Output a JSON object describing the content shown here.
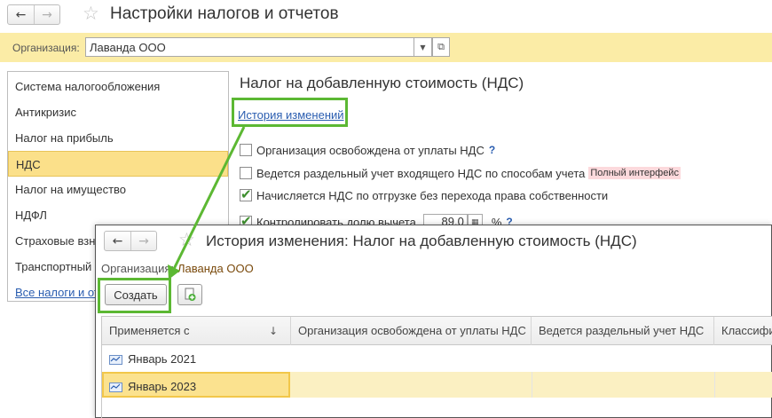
{
  "main_window": {
    "title": "Настройки налогов и отчетов",
    "nav_back": "←",
    "nav_forward": "→",
    "favorite_icon": "star-icon",
    "organization": {
      "label": "Организация:",
      "value": "Лаванда ООО",
      "dropdown_icon": "▼",
      "open_icon": "⧉"
    },
    "sidebar": {
      "items": [
        {
          "label": "Система налогообложения"
        },
        {
          "label": "Антикризис"
        },
        {
          "label": "Налог на прибыль"
        },
        {
          "label": "НДС",
          "selected": true
        },
        {
          "label": "Налог на имущество"
        },
        {
          "label": "НДФЛ"
        },
        {
          "label": "Страховые взносы"
        },
        {
          "label": "Транспортный налог"
        },
        {
          "label": "Все налоги и отчеты"
        }
      ]
    },
    "content": {
      "title": "Налог на добавленную стоимость (НДС)",
      "history_link": "История изменений",
      "options": [
        {
          "label": "Организация освобождена от уплаты НДС",
          "checked": false,
          "help": "?"
        },
        {
          "label": "Ведется раздельный учет входящего НДС по способам учета",
          "checked": false,
          "badge": "Полный интерфейс"
        },
        {
          "label": "Начисляется НДС по отгрузке без перехода права собственности",
          "checked": true
        },
        {
          "label": "Контролировать долю вычета",
          "checked": true,
          "value": "89,0",
          "unit": "%",
          "help": "?"
        }
      ]
    }
  },
  "popup": {
    "title": "История изменения: Налог на добавленную стоимость (НДС)",
    "nav_back": "←",
    "nav_forward": "→",
    "organization_label": "Организация:",
    "organization_value": "Лаванда ООО",
    "create_button": "Создать",
    "copy_icon": "copy-add-icon",
    "table": {
      "columns": [
        "Применяется с",
        "Организация освобождена от уплаты НДС",
        "Ведется раздельный учет НДС",
        "Классифи"
      ],
      "sort_indicator": "↓",
      "rows": [
        {
          "period": "Январь 2021",
          "selected": false
        },
        {
          "period": "Январь 2023",
          "selected": true
        }
      ]
    }
  },
  "colors": {
    "org_bar": "#fbeca6",
    "selected": "#fbe08a",
    "link": "#2a5db0",
    "highlight_frame": "#5cb833",
    "badge": "#fcd9dc"
  }
}
